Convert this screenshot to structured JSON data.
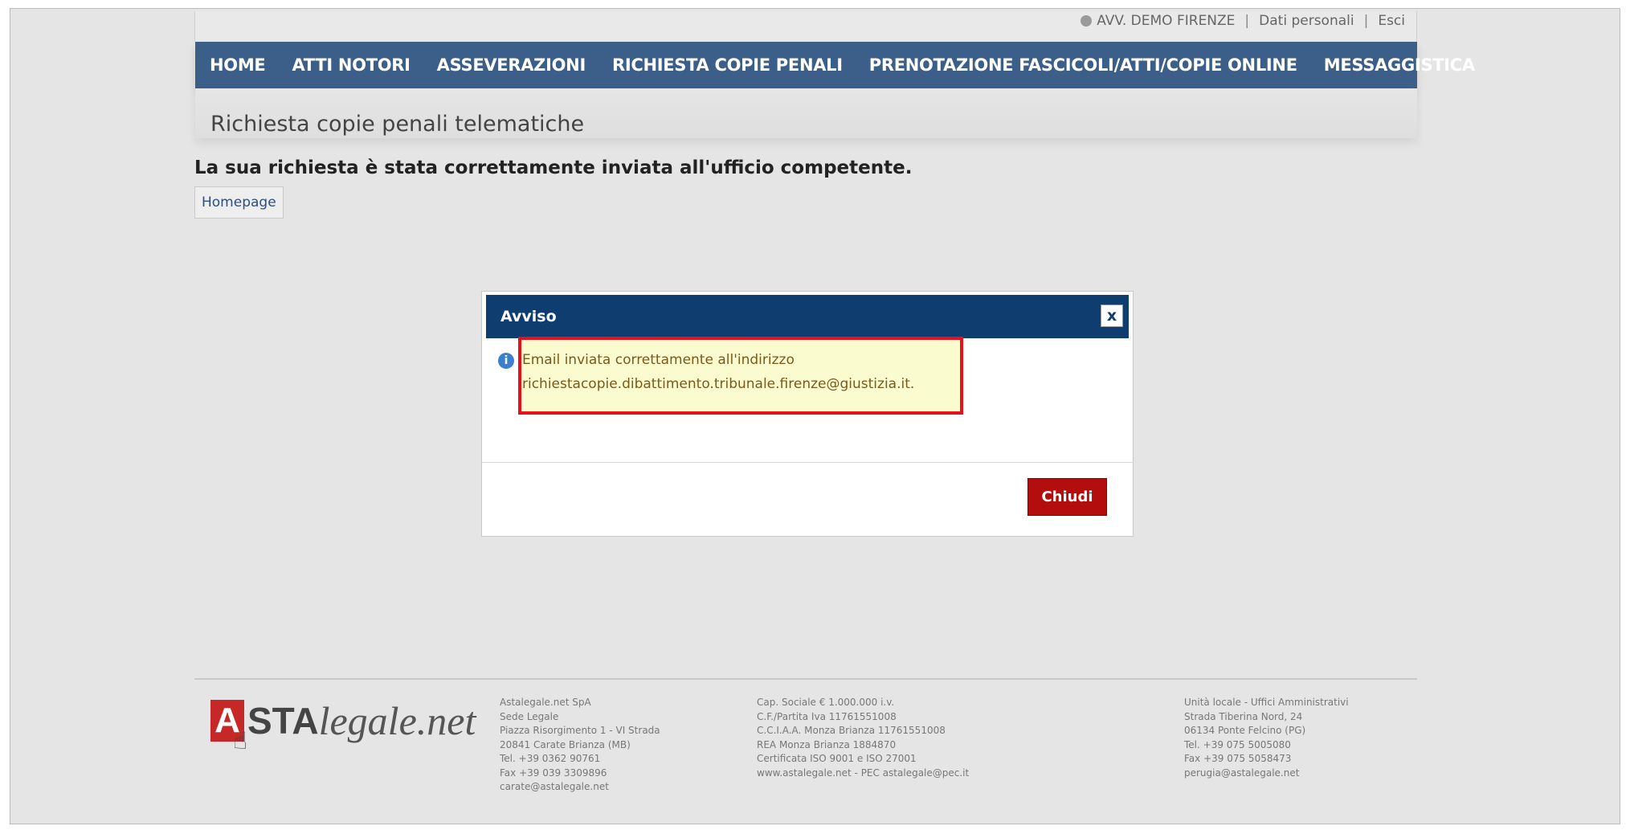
{
  "header": {
    "user_name": "AVV. DEMO FIRENZE",
    "personal_data": "Dati personali",
    "logout": "Esci"
  },
  "nav": {
    "items": [
      {
        "label": "HOME"
      },
      {
        "label": "ATTI NOTORI"
      },
      {
        "label": "ASSEVERAZIONI"
      },
      {
        "label": "RICHIESTA COPIE PENALI"
      },
      {
        "label": "PRENOTAZIONE FASCICOLI/ATTI/COPIE ONLINE"
      },
      {
        "label": "MESSAGGISTICA"
      }
    ]
  },
  "page": {
    "title": "Richiesta copie penali telematiche",
    "success_message": "La sua richiesta è stata correttamente inviata all'ufficio competente.",
    "homepage_button": "Homepage"
  },
  "dialog": {
    "title": "Avviso",
    "close_symbol": "x",
    "info_line1": "Email inviata correttamente all'indirizzo",
    "info_line2": "richiestacopie.dibattimento.tribunale.firenze@giustizia.it.",
    "close_button": "Chiudi",
    "highlight_color": "#e8101b"
  },
  "footer": {
    "logo_mark": "A",
    "logo_bold": "STA",
    "logo_italic": "legale.net",
    "col1": [
      "Astalegale.net SpA",
      "Sede Legale",
      "Piazza Risorgimento 1 - VI Strada",
      "20841 Carate Brianza (MB)",
      "Tel. +39 0362 90761",
      "Fax +39 039 3309896",
      "carate@astalegale.net"
    ],
    "col2": [
      "Cap. Sociale € 1.000.000 i.v.",
      "C.F./Partita Iva 11761551008",
      "C.C.I.A.A. Monza Brianza 11761551008",
      "REA Monza Brianza 1884870",
      "Certificata ISO 9001 e ISO 27001",
      "www.astalegale.net - PEC astalegale@pec.it"
    ],
    "col3": [
      "Unità locale - Uffici Amministrativi",
      "Strada Tiberina Nord, 24",
      "06134 Ponte Felcino (PG)",
      "Tel. +39 075 5005080",
      "Fax +39 075 5058473",
      "perugia@astalegale.net"
    ]
  },
  "colors": {
    "nav_bg": "#3b5f88",
    "dialog_header_bg": "#0f3d70",
    "close_button_bg": "#b30d0d"
  }
}
